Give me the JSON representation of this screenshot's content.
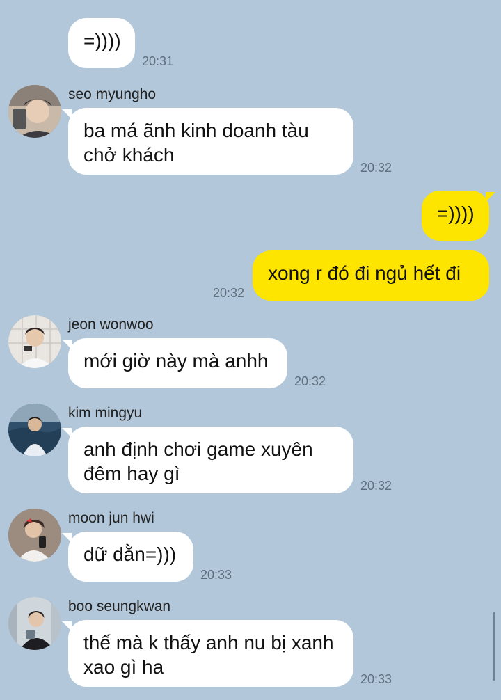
{
  "messages": [
    {
      "text": "=))))",
      "time": "20:31"
    },
    {
      "sender": "seo myungho",
      "avatar": "avatar-seo-myungho",
      "text": "ba má ãnh kinh doanh tàu chở khách",
      "time": "20:32"
    },
    {
      "text": "=))))"
    },
    {
      "text": "xong r đó đi ngủ hết đi",
      "time": "20:32"
    },
    {
      "sender": "jeon wonwoo",
      "avatar": "avatar-jeon-wonwoo",
      "text": "mới giờ này mà anhh",
      "time": "20:32"
    },
    {
      "sender": "kim mingyu",
      "avatar": "avatar-kim-mingyu",
      "text": "anh định chơi game xuyên đêm hay gì",
      "time": "20:32"
    },
    {
      "sender": "moon jun hwi",
      "avatar": "avatar-moon-jun-hwi",
      "text": "dữ dằn=)))",
      "time": "20:33"
    },
    {
      "sender": "boo seungkwan",
      "avatar": "avatar-boo-seungkwan",
      "text": "thế mà k thấy anh nu bị xanh xao gì ha",
      "time": "20:33"
    }
  ],
  "colors": {
    "background": "#b2c7d9",
    "incoming_bubble": "#ffffff",
    "outgoing_bubble": "#fee500"
  }
}
